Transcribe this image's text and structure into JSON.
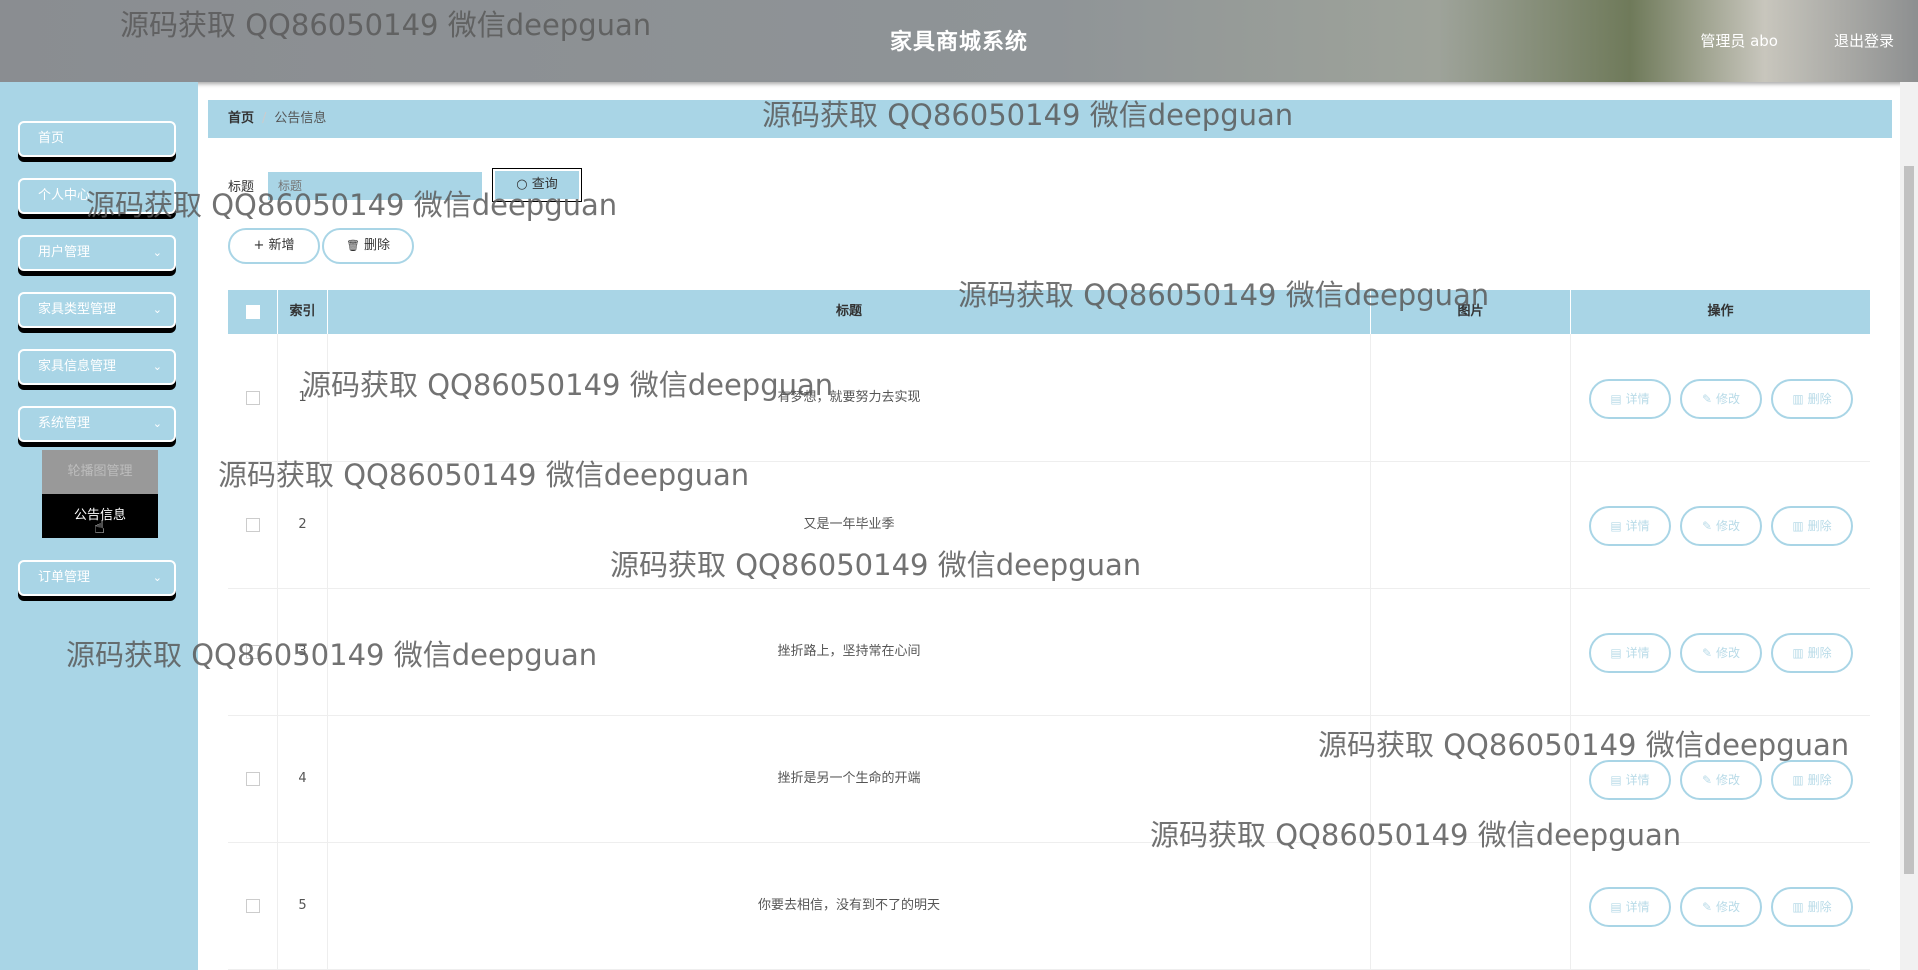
{
  "header": {
    "title": "家具商城系统",
    "user": "管理员 abo",
    "logout": "退出登录"
  },
  "sidebar": {
    "items": [
      {
        "label": "首页",
        "expandable": false
      },
      {
        "label": "个人中心",
        "expandable": false
      },
      {
        "label": "用户管理",
        "expandable": true
      },
      {
        "label": "家具类型管理",
        "expandable": true
      },
      {
        "label": "家具信息管理",
        "expandable": true
      },
      {
        "label": "系统管理",
        "expandable": true
      },
      {
        "label": "订单管理",
        "expandable": true
      }
    ],
    "submenu": [
      {
        "label": "轮播图管理"
      },
      {
        "label": "公告信息"
      }
    ],
    "chevron": "⌄"
  },
  "breadcrumb": {
    "home": "首页",
    "separator": "/",
    "current": "公告信息"
  },
  "search": {
    "label": "标题",
    "placeholder": "标题",
    "button": "查询",
    "button_icon": "○"
  },
  "actions": {
    "add": "新增",
    "add_icon": "+",
    "delete": "删除",
    "delete_icon": "🗑"
  },
  "table": {
    "headers": {
      "index": "索引",
      "title": "标题",
      "image": "图片",
      "ops": "操作"
    },
    "rows": [
      {
        "index": "1",
        "title": "有梦想，就要努力去实现"
      },
      {
        "index": "2",
        "title": "又是一年毕业季"
      },
      {
        "index": "3",
        "title": "挫折路上，坚持常在心间"
      },
      {
        "index": "4",
        "title": "挫折是另一个生命的开端"
      },
      {
        "index": "5",
        "title": "你要去相信，没有到不了的明天"
      }
    ],
    "ops": {
      "detail": "详情",
      "edit": "修改",
      "delete": "删除"
    }
  },
  "watermark": "源码获取 QQ86050149 微信deepguan",
  "colors": {
    "accent": "#a9d5e6",
    "header_bg": "#8d9194"
  }
}
